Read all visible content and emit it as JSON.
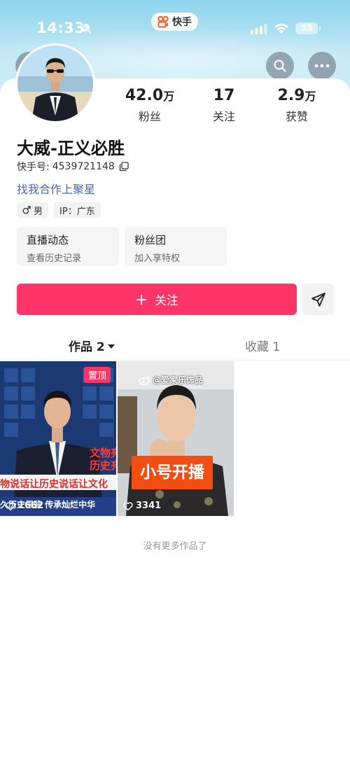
{
  "status_bar": {
    "time": "14:33",
    "app_name": "快手",
    "battery": "35"
  },
  "nav": {
    "back_icon": "chevron-left-icon",
    "search_icon": "search-icon",
    "more_icon": "more-dots-icon"
  },
  "profile": {
    "name": "大威-正义必胜",
    "kuaishou_id_label": "快手号:",
    "kuaishou_id": "4539721148",
    "link_text": "找我合作上聚星",
    "tags": {
      "gender": "男",
      "ip": "IP：广东"
    }
  },
  "stats": {
    "fans": {
      "value": "42.0",
      "unit": "万",
      "label": "粉丝"
    },
    "following": {
      "value": "17",
      "unit": "",
      "label": "关注"
    },
    "likes": {
      "value": "2.9",
      "unit": "万",
      "label": "获赞"
    }
  },
  "features": [
    {
      "title": "直播动态",
      "subtitle": "查看历史记录"
    },
    {
      "title": "粉丝团",
      "subtitle": "加入享特权"
    }
  ],
  "actions": {
    "follow_label": "关注",
    "share_icon": "paper-plane-icon"
  },
  "tabs": {
    "works_label": "作品 2",
    "favorites_label": "收藏 1"
  },
  "videos": [
    {
      "pinned_label": "置顶",
      "likes": "1662",
      "overlay_right_1": "文物亮",
      "overlay_right_2": "历史亮",
      "caption": "物说话让历史说话让文化",
      "ticker": "久历史根脉 传承灿烂中华"
    },
    {
      "likes": "3341",
      "watermark": "@爱家乐饰品",
      "title_overlay": "小号开播"
    }
  ],
  "footer": {
    "no_more": "没有更多作品了"
  },
  "colors": {
    "brand": "#fe3566",
    "link": "#4a68a8"
  }
}
